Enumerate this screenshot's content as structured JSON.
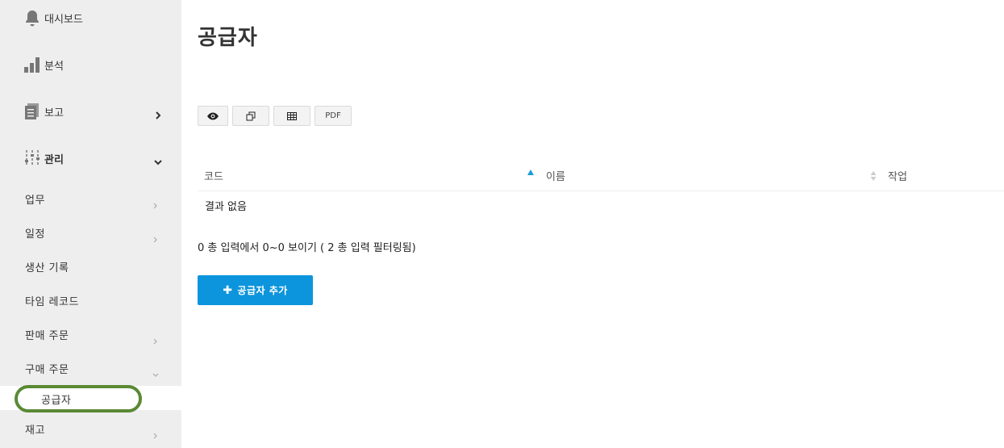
{
  "sidebar": {
    "top_items": [
      {
        "label": "대시보드",
        "icon": "bell-icon"
      },
      {
        "label": "분석",
        "icon": "bar-chart-icon"
      },
      {
        "label": "보고",
        "icon": "document-stack-icon"
      },
      {
        "label": "관리",
        "icon": "sliders-icon"
      }
    ],
    "sub_items": [
      {
        "label": "업무"
      },
      {
        "label": "일정"
      },
      {
        "label": "생산 기록"
      },
      {
        "label": "타임 레코드"
      },
      {
        "label": "판매 주문"
      },
      {
        "label": "구매 주문"
      }
    ],
    "active_item": {
      "label": "공급자"
    },
    "last_item": {
      "label": "재고"
    }
  },
  "main": {
    "title": "공급자",
    "toolbar": {
      "buttons": [
        {
          "icon": "eye-icon"
        },
        {
          "icon": "copy-icon"
        },
        {
          "icon": "spreadsheet-icon"
        },
        {
          "label": "PDF"
        }
      ]
    },
    "table": {
      "columns": [
        "코드",
        "이름",
        "작업"
      ],
      "empty_text": "결과 없음"
    },
    "info": "0 총 입력에서 0~0 보이기 ( 2 총 입력 필터링됨)",
    "add_button": {
      "plus": "✚",
      "label": "공급자 추가"
    }
  },
  "colors": {
    "sidebar_bg": "#eeeeee",
    "accent": "#0c95dc",
    "highlight": "#5a8a34"
  }
}
